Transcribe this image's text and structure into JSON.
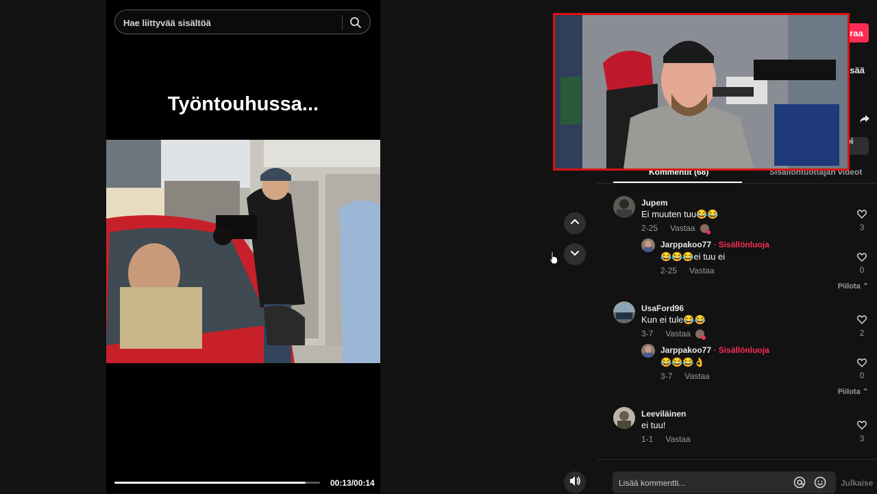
{
  "search": {
    "placeholder": "Hae liittyvää sisältöä"
  },
  "video": {
    "caption": "Työntouhussa...",
    "progress": 0.93,
    "time": "00:13/00:14"
  },
  "side": {
    "follow_label": "Seuraa",
    "more_label": "Lisää",
    "copy_label": "Kopioi linkki"
  },
  "tabs": [
    {
      "label": "Kommentit (68)"
    },
    {
      "label": "Sisällöntuottajan videot"
    }
  ],
  "comments": [
    {
      "user": "Jupem",
      "text": "Ei muuten tuu😂😂",
      "date": "2-25",
      "reply": "Vastaa",
      "likes": "3",
      "replies": [
        {
          "user": "Jarppakoo77",
          "creator": "· Sisällönluoja",
          "text": "😂😂😂ei tuu ei",
          "date": "2-25",
          "reply": "Vastaa",
          "likes": "0"
        }
      ],
      "hide": "Piilota"
    },
    {
      "user": "UsaFord96",
      "text": "Kun ei tule😂😂",
      "date": "3-7",
      "reply": "Vastaa",
      "likes": "2",
      "replies": [
        {
          "user": "Jarppakoo77",
          "creator": "· Sisällönluoja",
          "text": "😂😂😂👌",
          "date": "3-7",
          "reply": "Vastaa",
          "likes": "0"
        }
      ],
      "hide": "Piilota"
    },
    {
      "user": "Leeviläinen",
      "text": "ei tuu!",
      "date": "1-1",
      "reply": "Vastaa",
      "likes": "3"
    }
  ],
  "composer": {
    "placeholder": "Lisää kommentti...",
    "post_label": "Julkaise"
  },
  "colors": {
    "accent": "#fe2c55",
    "webcam_border": "#e01010"
  },
  "icons": [
    "search-icon",
    "chevron-up-icon",
    "chevron-down-icon",
    "heart-icon",
    "at-icon",
    "emoji-icon",
    "volume-icon",
    "share-icon"
  ]
}
